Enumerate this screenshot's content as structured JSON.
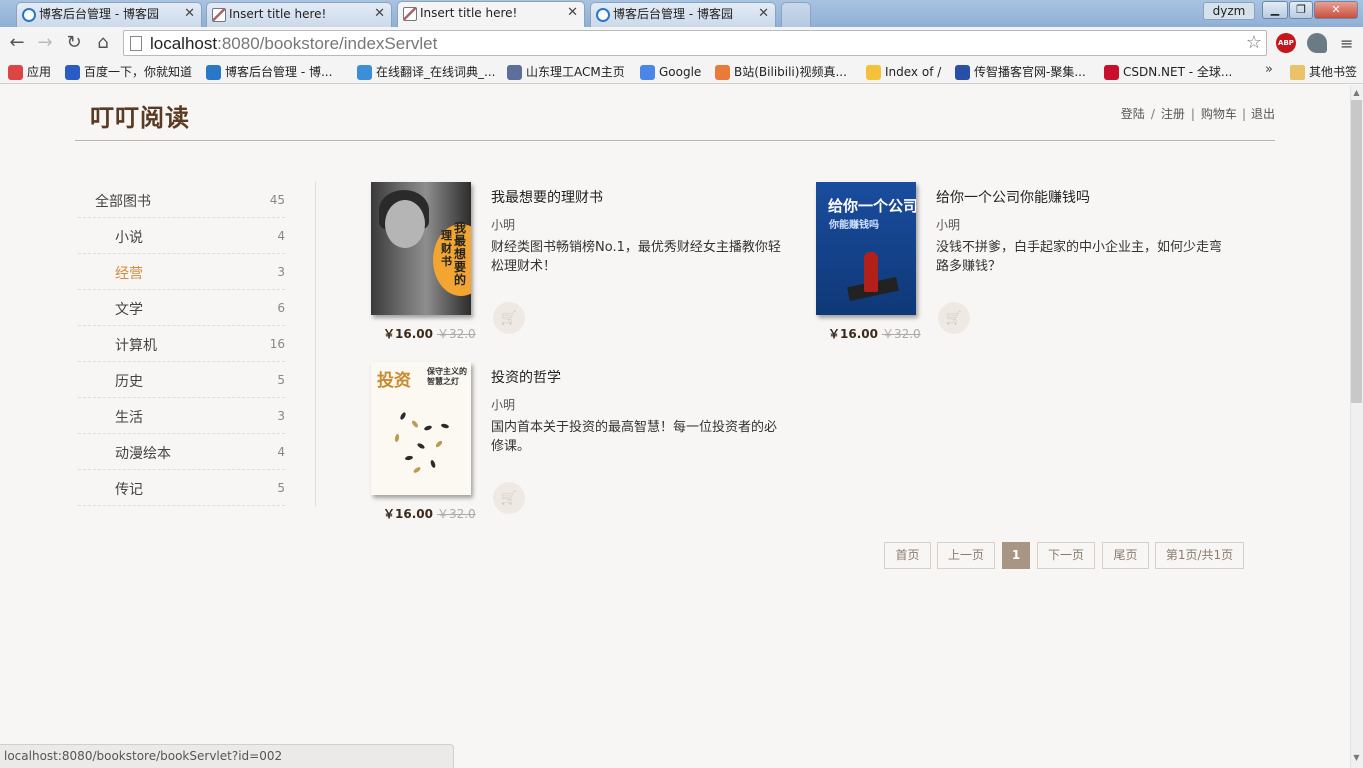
{
  "browser": {
    "tabs": [
      {
        "title": "博客后台管理 - 博客园",
        "icon": "cnblogs-icon",
        "active": false
      },
      {
        "title": "Insert title here!",
        "icon": "page-icon",
        "active": false
      },
      {
        "title": "Insert title here!",
        "icon": "page-icon",
        "active": true
      },
      {
        "title": "博客后台管理 - 博客园",
        "icon": "cnblogs-icon",
        "active": false
      }
    ],
    "user_badge": "dyzm",
    "window_controls": {
      "minimize": "▁",
      "maximize": "❐",
      "close": "✕"
    },
    "url_host": "localhost",
    "url_rest": ":8080/bookstore/indexServlet",
    "bookmarks": [
      {
        "label": "应用",
        "color": "#d44"
      },
      {
        "label": "百度一下，你就知道",
        "color": "#2b5bc7"
      },
      {
        "label": "博客后台管理 - 博...",
        "color": "#2a76c9"
      },
      {
        "label": "在线翻译_在线词典_...",
        "color": "#3a8fd8"
      },
      {
        "label": "山东理工ACM主页",
        "color": "#5b6f9a"
      },
      {
        "label": "Google",
        "color": "#4a86e8"
      },
      {
        "label": "B站(Bilibili)视频真...",
        "color": "#e87a3a"
      },
      {
        "label": "Index of /",
        "color": "#f3c13a"
      },
      {
        "label": "传智播客官网-聚集...",
        "color": "#2a4fa8"
      },
      {
        "label": "CSDN.NET - 全球...",
        "color": "#c8102e"
      }
    ],
    "bookmarks_overflow": "»",
    "other_bookmarks": "其他书签",
    "status_url": "localhost:8080/bookstore/bookServlet?id=002"
  },
  "site": {
    "logo": "叮叮阅读",
    "nav": {
      "login": "登陆",
      "slash": "/",
      "register": "注册",
      "pipe": "|",
      "cart": "购物车",
      "logout": "退出"
    }
  },
  "categories": [
    {
      "name": "全部图书",
      "count": "45"
    },
    {
      "name": "小说",
      "count": "4"
    },
    {
      "name": "经营",
      "count": "3"
    },
    {
      "name": "文学",
      "count": "6"
    },
    {
      "name": "计算机",
      "count": "16"
    },
    {
      "name": "历史",
      "count": "5"
    },
    {
      "name": "生活",
      "count": "3"
    },
    {
      "name": "动漫绘本",
      "count": "4"
    },
    {
      "name": "传记",
      "count": "5"
    }
  ],
  "active_category": "经营",
  "books": [
    {
      "title": "我最想要的理财书",
      "author": "小明",
      "description": "财经类图书畅销榜No.1，最优秀财经女主播教你轻松理财术！",
      "price": "￥16.00",
      "old_price": "￥32.0",
      "cover_text": [
        "我最想要的",
        "理财书"
      ]
    },
    {
      "title": "给你一个公司你能赚钱吗",
      "author": "小明",
      "description": "没钱不拼爹，白手起家的中小企业主，如何少走弯路多赚钱？",
      "price": "￥16.00",
      "old_price": "￥32.0",
      "cover_text": [
        "给你一个公司",
        "你能赚钱吗"
      ]
    },
    {
      "title": "投资的哲学",
      "author": "小明",
      "description": "国内首本关于投资的最高智慧！每一位投资者的必修课。",
      "price": "￥16.00",
      "old_price": "￥32.0",
      "cover_text": [
        "投资",
        "保守主义的智慧之灯"
      ]
    }
  ],
  "cart_icon": "🛒",
  "pagination": {
    "first": "首页",
    "prev": "上一页",
    "current": "1",
    "next": "下一页",
    "last": "尾页",
    "info": "第1页/共1页"
  }
}
